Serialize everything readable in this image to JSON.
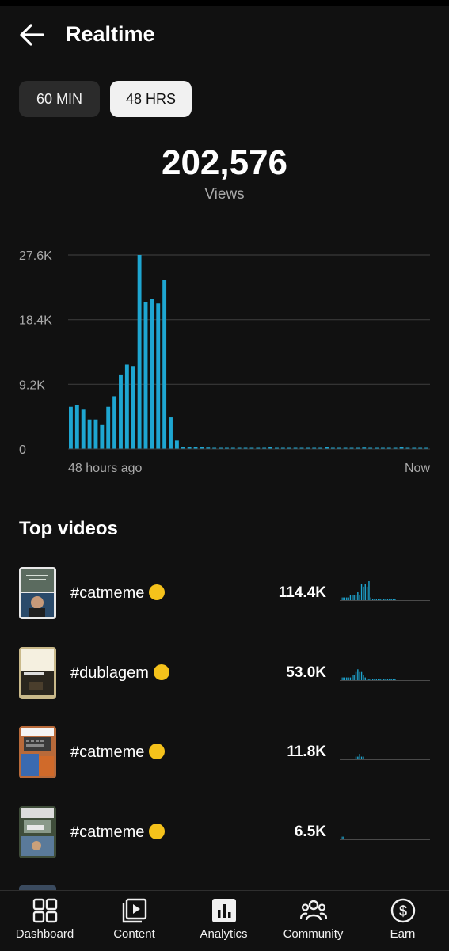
{
  "header": {
    "title": "Realtime"
  },
  "range_toggle": {
    "options": [
      "60 MIN",
      "48 HRS"
    ],
    "selected": "48 HRS"
  },
  "summary": {
    "total_views": "202,576",
    "label": "Views"
  },
  "chart_data": {
    "type": "bar",
    "y_tick_labels": [
      "27.6K",
      "18.4K",
      "9.2K",
      "0"
    ],
    "y_ticks": [
      27600,
      18400,
      9200,
      0
    ],
    "ylim": [
      0,
      27600
    ],
    "x_start_label": "48 hours ago",
    "x_end_label": "Now",
    "grid": true,
    "values": [
      6000,
      6200,
      5600,
      4200,
      4200,
      3400,
      6000,
      7500,
      10600,
      12000,
      11800,
      27600,
      20900,
      21300,
      20700,
      24000,
      4500,
      1200,
      300,
      250,
      250,
      250,
      200,
      150,
      150,
      150,
      150,
      150,
      150,
      150,
      150,
      150,
      300,
      150,
      150,
      150,
      150,
      150,
      150,
      150,
      150,
      300,
      150,
      150,
      150,
      150,
      150,
      200,
      150,
      150,
      150,
      150,
      150,
      300,
      150,
      150,
      150,
      150
    ]
  },
  "top_videos": {
    "title": "Top videos",
    "items": [
      {
        "title": "#catmeme",
        "emoji": "loudly-crying-face-emoji",
        "views": "114.4K",
        "spark": [
          1,
          1,
          1,
          1,
          1,
          2,
          2,
          2,
          2,
          3,
          2,
          6,
          5,
          6,
          5,
          7,
          1,
          0,
          0,
          0,
          0,
          0,
          0,
          0,
          0,
          0,
          0,
          0,
          0,
          0
        ]
      },
      {
        "title": "#dublagem",
        "emoji": "face-with-raised-eyebrow-emoji",
        "views": "53.0K",
        "spark": [
          1,
          1,
          1,
          1,
          1,
          1,
          2,
          2,
          3,
          4,
          3,
          3,
          2,
          1,
          0,
          0,
          0,
          0,
          0,
          0,
          0,
          0,
          0,
          0,
          0,
          0,
          0,
          0,
          0,
          0
        ]
      },
      {
        "title": "#catmeme",
        "emoji": "pleading-face-emoji",
        "views": "11.8K",
        "spark": [
          0,
          0,
          0,
          0,
          0,
          0,
          0,
          0,
          1,
          1,
          2,
          1,
          1,
          0,
          0,
          0,
          0,
          0,
          0,
          0,
          0,
          0,
          0,
          0,
          0,
          0,
          0,
          0,
          0,
          0
        ]
      },
      {
        "title": "#catmeme",
        "emoji": "thinking-face-emoji",
        "views": "6.5K",
        "spark": [
          1,
          1,
          0,
          0,
          0,
          0,
          0,
          0,
          0,
          0,
          0,
          0,
          0,
          0,
          0,
          0,
          0,
          0,
          0,
          0,
          0,
          0,
          0,
          0,
          0,
          0,
          0,
          0,
          0,
          0
        ]
      }
    ]
  },
  "bottom_nav": {
    "items": [
      {
        "label": "Dashboard",
        "icon": "dashboard-icon"
      },
      {
        "label": "Content",
        "icon": "content-icon"
      },
      {
        "label": "Analytics",
        "icon": "analytics-icon",
        "active": true
      },
      {
        "label": "Community",
        "icon": "community-icon"
      },
      {
        "label": "Earn",
        "icon": "earn-icon"
      }
    ]
  },
  "colors": {
    "background": "#111111",
    "bar": "#1ea6d1",
    "grid": "#3a3a3a",
    "chip_selected": "#f1f1f1",
    "chip_unselected": "#2b2b2b"
  }
}
